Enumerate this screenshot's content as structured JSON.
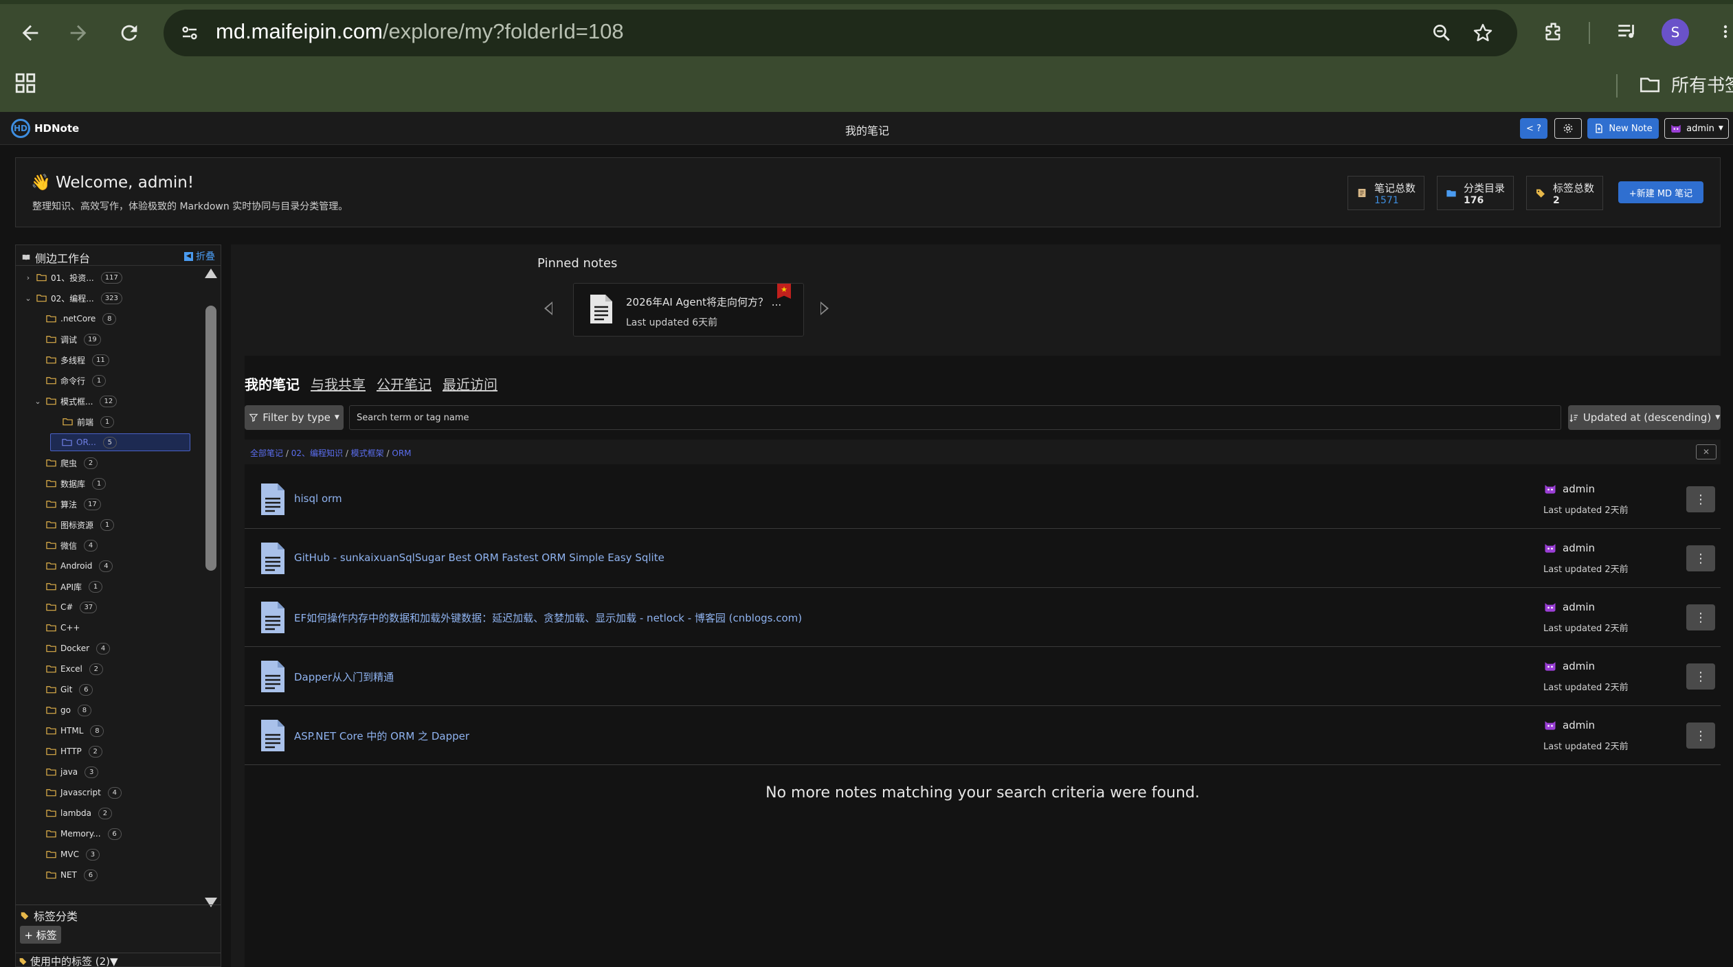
{
  "browser": {
    "url_host": "md.maifeipin.com",
    "url_path": "/explore/my?folderId=108",
    "profile_initial": "S",
    "bookmarks_label": "所有书签"
  },
  "app": {
    "logo_text": "HDNote",
    "logo_mark": "HD",
    "page_title": "我的笔记",
    "code_button": "< ?",
    "new_note_button": "New Note",
    "user_menu": "admin"
  },
  "welcome": {
    "title": "👋 Welcome, admin!",
    "subtitle": "整理知识、高效写作，体验极致的 Markdown 实时协同与目录分类管理。",
    "stats": [
      {
        "label": "笔记总数",
        "value": "1571"
      },
      {
        "label": "分类目录",
        "value": "176"
      },
      {
        "label": "标签总数",
        "value": "2"
      }
    ],
    "new_md_button": "+新建 MD 笔记"
  },
  "sidebar": {
    "title": "侧边工作台",
    "collapse_label": "折叠",
    "folders": [
      {
        "label": "01、投资...",
        "count": "117",
        "level": 0,
        "chevron": "›"
      },
      {
        "label": "02、编程...",
        "count": "323",
        "level": 0,
        "chevron": "⌄"
      },
      {
        "label": ".netCore",
        "count": "8",
        "level": 1
      },
      {
        "label": "调试",
        "count": "19",
        "level": 1
      },
      {
        "label": "多线程",
        "count": "11",
        "level": 1
      },
      {
        "label": "命令行",
        "count": "1",
        "level": 1
      },
      {
        "label": "模式框...",
        "count": "12",
        "level": 1,
        "chevron": "⌄"
      },
      {
        "label": "前端",
        "count": "1",
        "level": 2
      },
      {
        "label": "OR...",
        "count": "5",
        "level": 2,
        "active": true
      },
      {
        "label": "爬虫",
        "count": "2",
        "level": 1
      },
      {
        "label": "数据库",
        "count": "1",
        "level": 1
      },
      {
        "label": "算法",
        "count": "17",
        "level": 1
      },
      {
        "label": "图标资源",
        "count": "1",
        "level": 1
      },
      {
        "label": "微信",
        "count": "4",
        "level": 1
      },
      {
        "label": "Android",
        "count": "4",
        "level": 1
      },
      {
        "label": "API库",
        "count": "1",
        "level": 1
      },
      {
        "label": "C#",
        "count": "37",
        "level": 1
      },
      {
        "label": "C++",
        "count": "",
        "level": 1
      },
      {
        "label": "Docker",
        "count": "4",
        "level": 1
      },
      {
        "label": "Excel",
        "count": "2",
        "level": 1
      },
      {
        "label": "Git",
        "count": "6",
        "level": 1
      },
      {
        "label": "go",
        "count": "8",
        "level": 1
      },
      {
        "label": "HTML",
        "count": "8",
        "level": 1
      },
      {
        "label": "HTTP",
        "count": "2",
        "level": 1
      },
      {
        "label": "java",
        "count": "3",
        "level": 1
      },
      {
        "label": "Javascript",
        "count": "4",
        "level": 1
      },
      {
        "label": "lambda",
        "count": "2",
        "level": 1
      },
      {
        "label": "Memory...",
        "count": "6",
        "level": 1
      },
      {
        "label": "MVC",
        "count": "3",
        "level": 1
      },
      {
        "label": "NET",
        "count": "6",
        "level": 1
      }
    ],
    "tags_section": "标签分类",
    "add_tag": "+ 标签",
    "tags_in_use": "使用中的标签 (2)▼"
  },
  "pinned": {
    "title": "Pinned notes",
    "card_title": "2026年AI Agent将走向何方？ ...",
    "card_updated": "Last updated 6天前"
  },
  "tabs": [
    {
      "label": "我的笔记",
      "active": true
    },
    {
      "label": "与我共享",
      "active": false
    },
    {
      "label": "公开笔记",
      "active": false
    },
    {
      "label": "最近访问",
      "active": false
    }
  ],
  "toolbar": {
    "filter_label": "Filter by type",
    "search_placeholder": "Search term or tag name",
    "sort_label": "Updated at (descending)"
  },
  "breadcrumb": {
    "parts": [
      "全部笔记",
      "02、编程知识",
      "模式框架",
      "ORM"
    ],
    "clear": "✕"
  },
  "notes": [
    {
      "title": "hisql orm",
      "author": "admin",
      "updated": "Last updated 2天前"
    },
    {
      "title": "GitHub - sunkaixuanSqlSugar Best ORM Fastest ORM Simple Easy Sqlite",
      "author": "admin",
      "updated": "Last updated 2天前"
    },
    {
      "title": "EF如何操作内存中的数据和加载外键数据：延迟加载、贪婪加载、显示加载 - netlock - 博客园 (cnblogs.com)",
      "author": "admin",
      "updated": "Last updated 2天前"
    },
    {
      "title": "Dapper从入门到精通",
      "author": "admin",
      "updated": "Last updated 2天前"
    },
    {
      "title": "ASP.NET Core 中的 ORM 之 Dapper",
      "author": "admin",
      "updated": "Last updated 2天前"
    }
  ],
  "no_more": "No more notes matching your search criteria were found.",
  "colors": {
    "accent": "#2f6fd0",
    "chrome_bg": "#3a4a2f",
    "link": "#8fb3f0",
    "breadcrumb": "#5b6ef0",
    "avatar": "#9b3fd6"
  },
  "icons": [
    "back-icon",
    "forward-icon",
    "reload-icon",
    "tune-icon",
    "zoom-icon",
    "star-icon",
    "extensions-icon",
    "media-icon",
    "menu-icon",
    "apps-icon",
    "folder-icon",
    "gear-icon",
    "note-icon",
    "document-icon",
    "avatar-icon",
    "filter-icon",
    "sort-icon",
    "more-icon",
    "tag-icon",
    "pin-badge-icon"
  ]
}
